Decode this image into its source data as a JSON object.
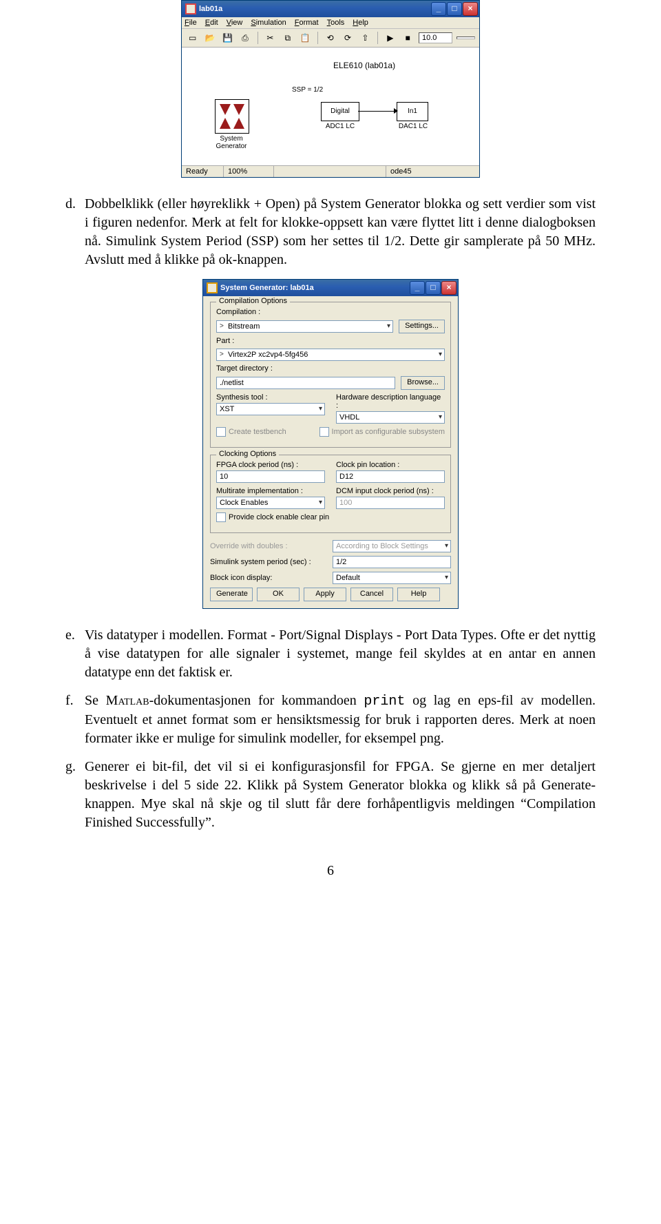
{
  "simulink_window": {
    "title": "lab01a",
    "menu": [
      "File",
      "Edit",
      "View",
      "Simulation",
      "Format",
      "Tools",
      "Help"
    ],
    "toolbar_value": "10.0",
    "model_title": "ELE610 (lab01a)",
    "ssp_label": "SSP = 1/2",
    "blocks": {
      "sysgen_label": "System\nGenerator",
      "adc_text": "Digital",
      "adc_label": "ADC1 LC",
      "dac_text": "In1",
      "dac_label": "DAC1 LC"
    },
    "status": {
      "ready": "Ready",
      "zoom": "100%",
      "solver": "ode45"
    }
  },
  "paragraphs": {
    "d": "Dobbelklikk (eller høyreklikk + Open) på System Generator blokka og sett verdier som vist i figuren nedenfor. Merk at felt for klokke-oppsett kan være flyttet litt i denne dialogboksen nå. Simulink System Period (SSP) som her settes til 1/2. Dette gir samplerate på 50 MHz. Avslutt med å klikke på ok-knappen.",
    "e": "Vis datatyper i modellen. Format - Port/Signal Displays - Port Data Types. Ofte er det nyttig å vise datatypen for alle signaler i systemet, mange feil skyldes at en antar en annen datatype enn det faktisk er.",
    "f_pre": "Se ",
    "f_matlab": "Matlab",
    "f_mid": "-dokumentasjonen for kommandoen ",
    "f_cmd": "print",
    "f_post": " og lag en eps-fil av modellen. Eventuelt et annet format som er hensiktsmessig for bruk i rapporten deres. Merk at noen formater ikke er mulige for simulink modeller, for eksempel png.",
    "g": "Generer ei bit-fil, det vil si ei konfigurasjonsfil for FPGA. Se gjerne en mer detaljert beskrivelse i del 5 side 22. Klikk på System Generator blokka og klikk så på Generate-knappen. Mye skal nå skje og til slutt får dere forhåpentligvis meldingen “Compilation Finished Successfully”."
  },
  "markers": {
    "d": "d.",
    "e": "e.",
    "f": "f.",
    "g": "g."
  },
  "dialog": {
    "title": "System Generator: lab01a",
    "group1": "Compilation Options",
    "compilation_label": "Compilation :",
    "compilation_value": "Bitstream",
    "settings_btn": "Settings...",
    "part_label": "Part :",
    "part_value": "Virtex2P xc2vp4-5fg456",
    "target_label": "Target directory :",
    "target_value": "./netlist",
    "browse_btn": "Browse...",
    "synth_label": "Synthesis tool :",
    "synth_value": "XST",
    "hdl_label": "Hardware description language :",
    "hdl_value": "VHDL",
    "create_tb": "Create testbench",
    "import_cfg": "Import as configurable subsystem",
    "group2": "Clocking Options",
    "fpga_clk_label": "FPGA clock period (ns) :",
    "fpga_clk_value": "10",
    "clk_pin_label": "Clock pin location :",
    "clk_pin_value": "D12",
    "multirate_label": "Multirate implementation :",
    "multirate_value": "Clock Enables",
    "dcm_label": "DCM input clock period (ns) :",
    "dcm_value": "100",
    "provide_ce": "Provide clock enable clear pin",
    "override_label": "Override with doubles :",
    "override_value": "According to Block Settings",
    "ssp_label": "Simulink system period (sec) :",
    "ssp_value": "1/2",
    "icon_label": "Block icon display:",
    "icon_value": "Default",
    "buttons": [
      "Generate",
      "OK",
      "Apply",
      "Cancel",
      "Help"
    ]
  },
  "page_number": "6"
}
